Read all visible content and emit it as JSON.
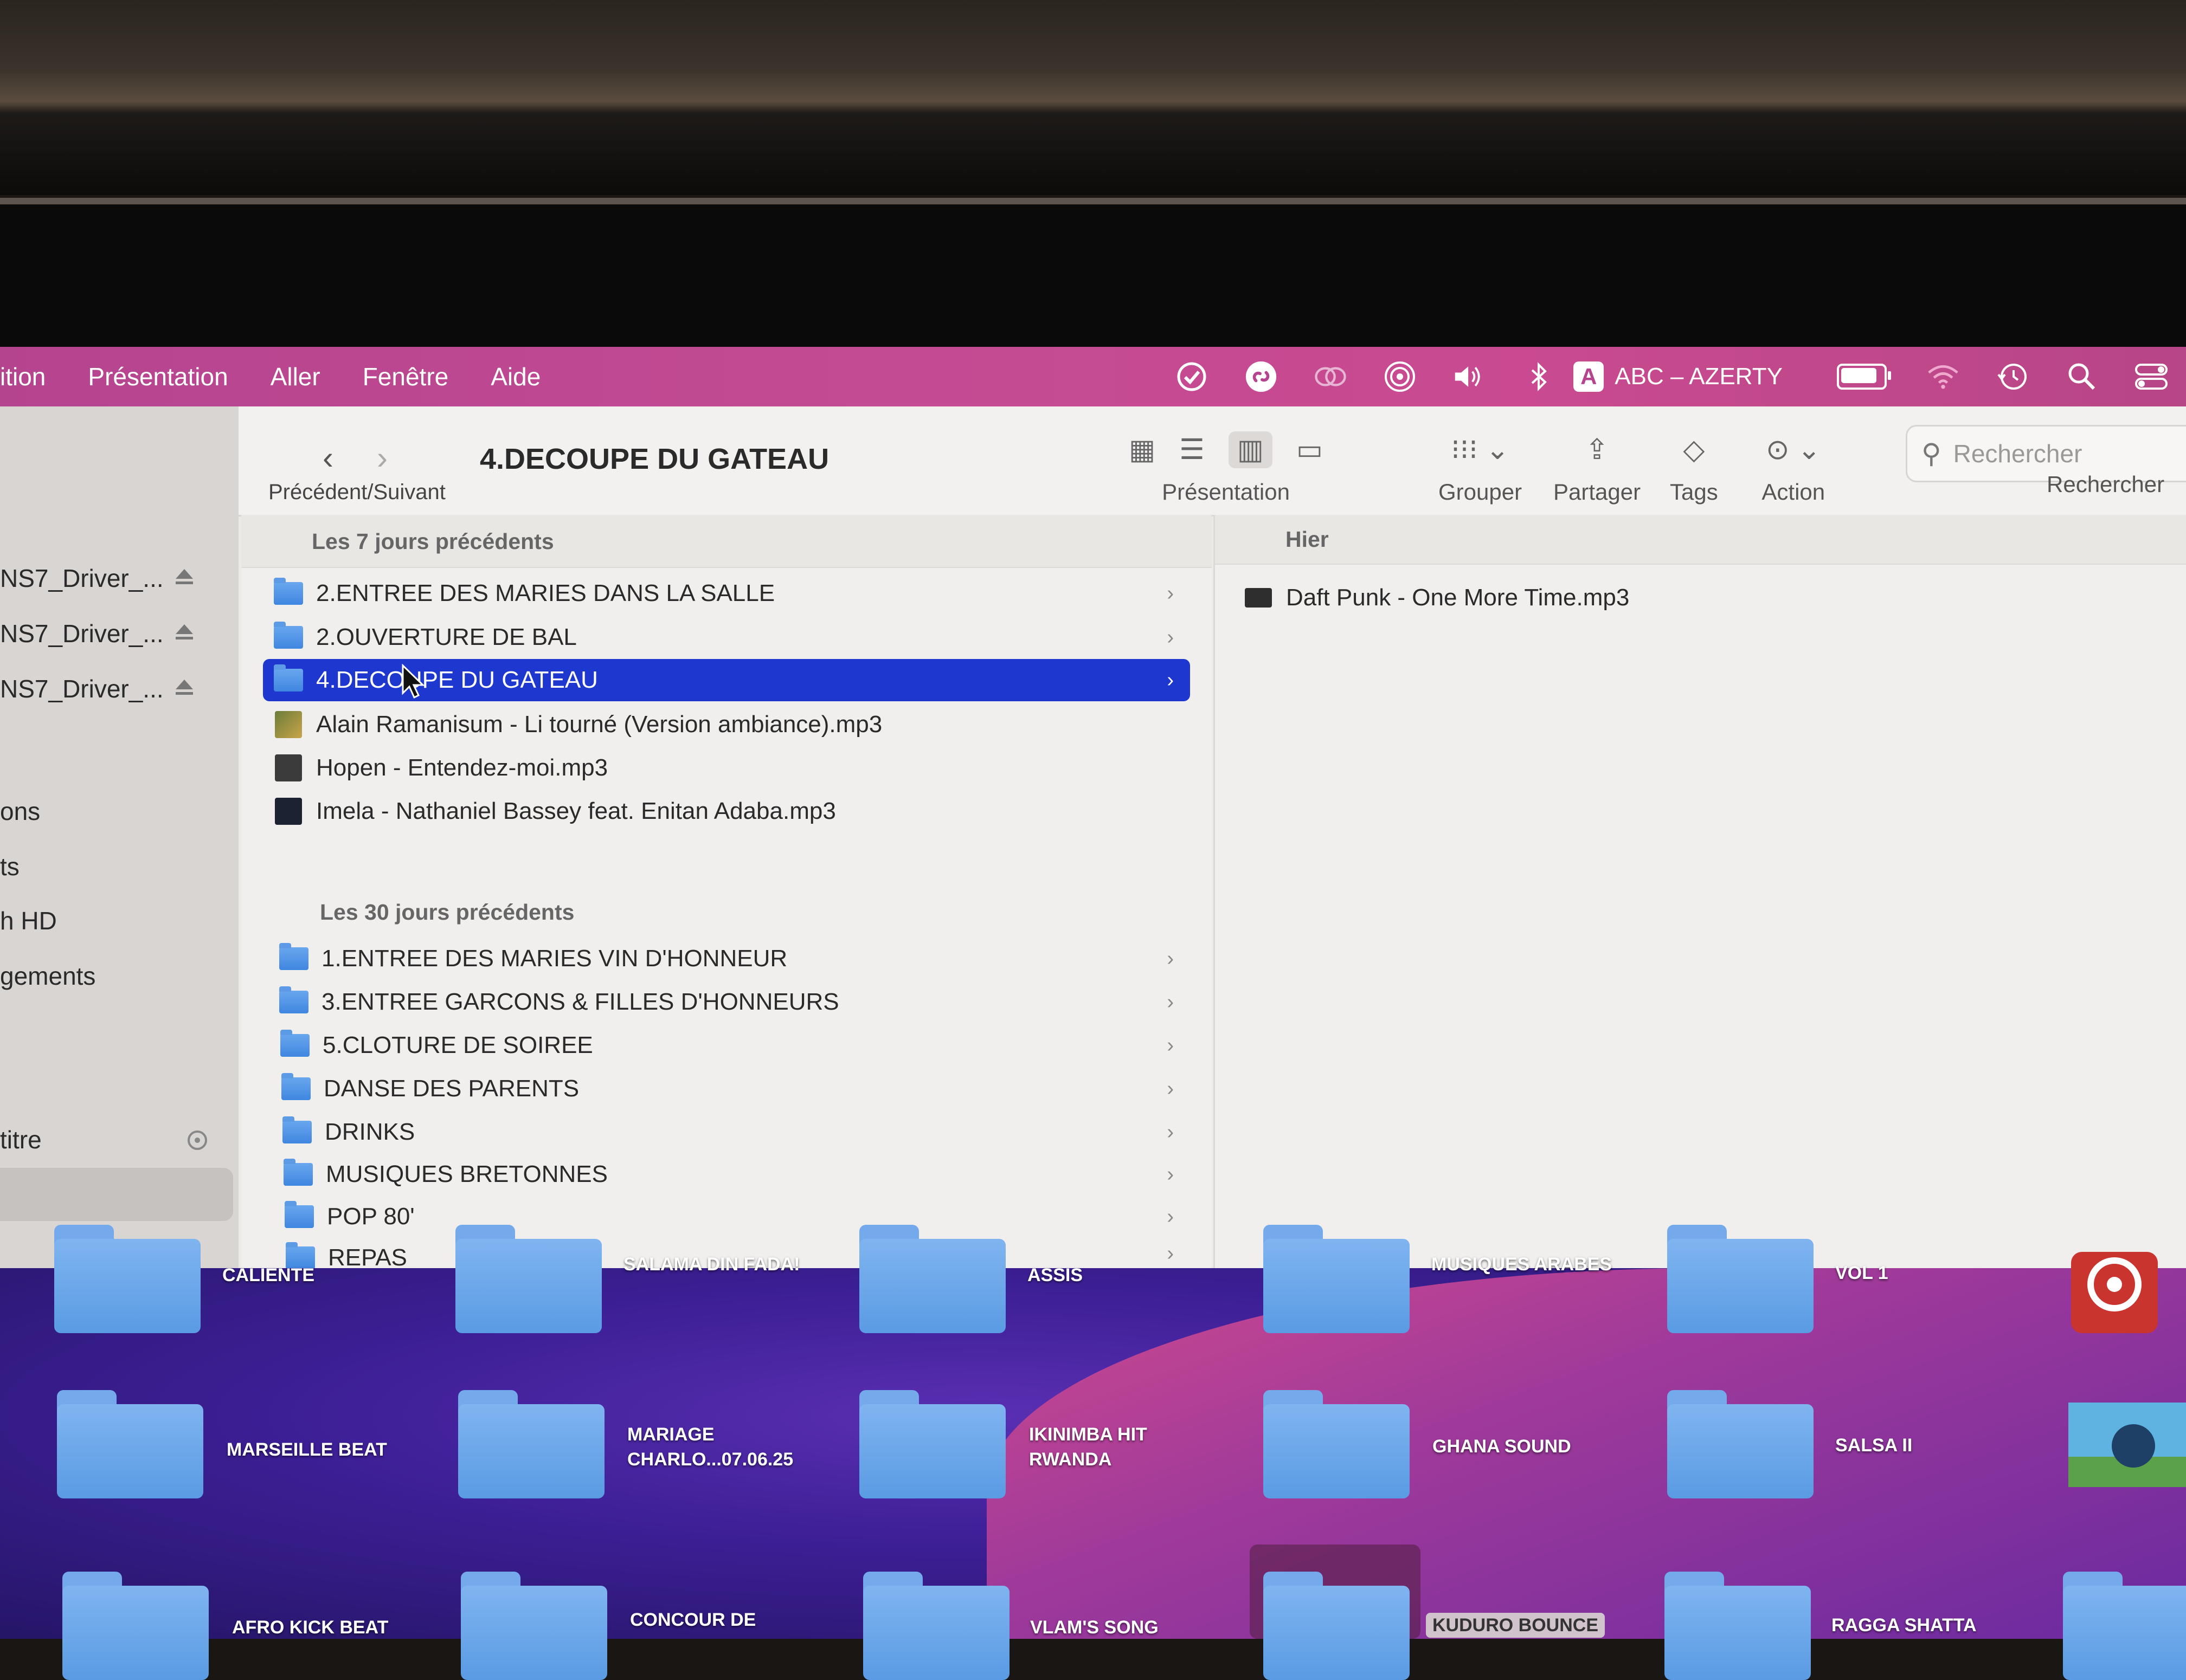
{
  "menubar": {
    "items": [
      "ition",
      "Présentation",
      "Aller",
      "Fenêtre",
      "Aide"
    ],
    "keyboard": {
      "letter": "A",
      "label": "ABC – AZERTY"
    },
    "battery_level": 0.85
  },
  "sidebar": {
    "devices": [
      "NS7_Driver_...",
      "NS7_Driver_...",
      "NS7_Driver_..."
    ],
    "items": [
      "ons",
      "ts",
      "h HD",
      "gements"
    ],
    "tag_item": "titre"
  },
  "toolbar": {
    "title": "4.DECOUPE DU GATEAU",
    "nav_label": "Précédent/Suivant",
    "view_label": "Présentation",
    "group_label": "Grouper",
    "share_label": "Partager",
    "tags_label": "Tags",
    "action_label": "Action",
    "search_placeholder": "Rechercher",
    "search_label": "Rechercher"
  },
  "column1": {
    "section1": "Les 7 jours précédents",
    "section1_rows": [
      "2.ENTREE DES MARIES DANS LA SALLE",
      "2.OUVERTURE DE BAL",
      "4.DECOUPE DU GATEAU",
      "Alain Ramanisum - Li tourné (Version ambiance).mp3",
      "Hopen - Entendez-moi.mp3",
      "Imela - Nathaniel Bassey feat. Enitan Adaba.mp3"
    ],
    "section2": "Les 30 jours précédents",
    "section2_rows": [
      "1.ENTREE DES MARIES VIN D'HONNEUR",
      "3.ENTREE GARCONS & FILLES D'HONNEURS",
      "5.CLOTURE DE SOIREE",
      "DANSE DES PARENTS",
      "DRINKS",
      "MUSIQUES BRETONNES",
      "POP 80'",
      "REPAS"
    ]
  },
  "column2": {
    "section": "Hier",
    "rows": [
      "Daft Punk - One More Time.mp3"
    ]
  },
  "desktop": {
    "top_labels": [
      "CALIENTE",
      "SALAMA DIN FADA!",
      "ASSIS",
      "MUSIQUES ARABES",
      "VOL 1"
    ],
    "folders": [
      "MARSEILLE BEAT",
      "MARIAGE CHARLO...07.06.25",
      "IKINIMBA HIT RWANDA",
      "GHANA SOUND",
      "SALSA II",
      "AFRO KICK BEAT",
      "CONCOUR DE",
      "VLAM'S SONG",
      "KUDURO BOUNCE",
      "RAGGA SHATTA"
    ]
  }
}
